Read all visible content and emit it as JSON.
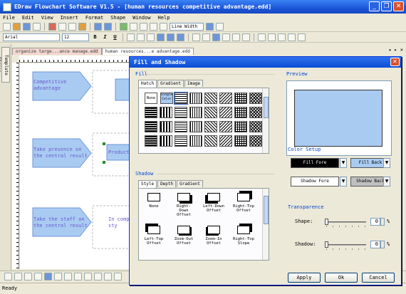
{
  "app": {
    "title": "EDraw Flowchart Software V1.5 - [human resources competitive advantage.edd]",
    "window_buttons": [
      "_",
      "❐",
      "✕"
    ]
  },
  "menu": [
    "File",
    "Edit",
    "View",
    "Insert",
    "Format",
    "Shape",
    "Window",
    "Help"
  ],
  "toolbar1": {
    "line_width_label": "Line Width"
  },
  "toolbar2": {
    "font_name": "Arial",
    "font_size": "12",
    "bold": "B",
    "italic": "I",
    "underline": "U"
  },
  "sidepanel": {
    "label": "Template Shapes"
  },
  "doc_tabs": [
    {
      "label": "organize targe...ance manage.edd",
      "active": false
    },
    {
      "label": "human resources...e advantage.edd",
      "active": true
    }
  ],
  "doc_nav": "◂ ▸ ✕",
  "canvas": {
    "shape_texts": [
      "Competitive\nadvantage",
      "Take presence on\nthe central result",
      "Product",
      "Take the staff on\nthe central result",
      "In comp\nsty"
    ]
  },
  "status": {
    "text": "Ready"
  },
  "dialog": {
    "title": "Fill and Shadow",
    "close": "✕",
    "fill": {
      "label": "Fill",
      "tabs": [
        "Hatch",
        "Gradient",
        "Image"
      ],
      "first_items": [
        "None",
        "Single Color"
      ]
    },
    "shadow": {
      "label": "Shadow",
      "tabs": [
        "Style",
        "Depth",
        "Gradient"
      ],
      "items": [
        "None",
        "Right-Down Offset",
        "Left-Down Offset",
        "Right-Top Offset",
        "Left-Top Offset",
        "Zoom-Out Offset",
        "Zoom-In Offset",
        "Right-Top Slope"
      ]
    },
    "preview": {
      "label": "Preview",
      "fill_color": "#a9cbf2"
    },
    "color_setup": {
      "label": "Color Setup",
      "fill_fore": "Fill Fore",
      "fill_back": "Fill Back",
      "shadow_fore": "Shadow Fore",
      "shadow_back": "Shadow Back"
    },
    "transparence": {
      "label": "Transparence",
      "shape_label": "Shape:",
      "shape_value": "0",
      "shadow_label": "Shadow:",
      "shadow_value": "0",
      "unit": "%"
    },
    "buttons": {
      "apply": "Apply",
      "ok": "Ok",
      "cancel": "Cancel"
    }
  },
  "colors": {
    "title_bar": "#1b56d8",
    "shape_fill": "#a9cbf2",
    "shape_text": "#6a5acd",
    "fill_back": "#a9cbf2",
    "shadow_back": "#c0c0c0"
  }
}
